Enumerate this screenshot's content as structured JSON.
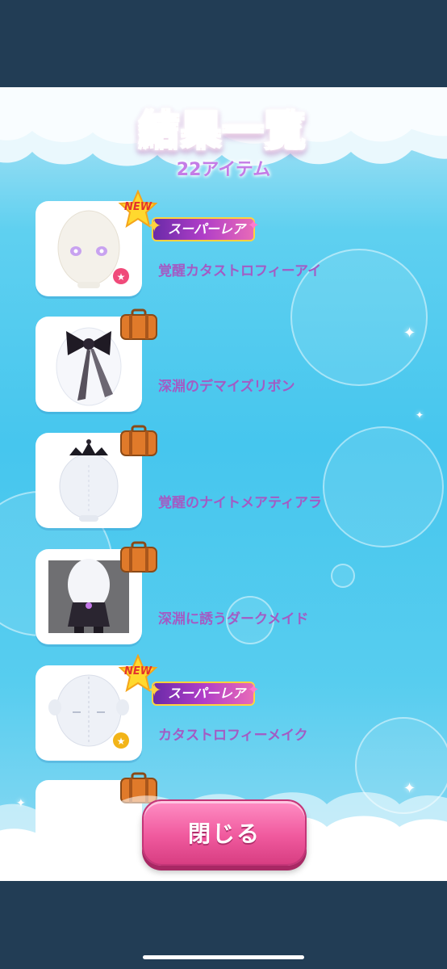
{
  "header": {
    "title": "結果一覧",
    "subtitle": "22アイテム"
  },
  "items": [
    {
      "name": "覚醒カタストロフィーアイ",
      "rarity": "スーパーレア",
      "badge": "NEW",
      "thumb_icon": "white-egg-face-with-purple-eyes-icon",
      "corner_icon": "pink-star-icon"
    },
    {
      "name": "深淵のデマイズリボン",
      "rarity": "",
      "badge": "case",
      "thumb_icon": "black-ribbon-icon",
      "corner_icon": ""
    },
    {
      "name": "覚醒のナイトメアティアラ",
      "rarity": "",
      "badge": "case",
      "thumb_icon": "tiara-avatar-icon",
      "corner_icon": ""
    },
    {
      "name": "深淵に誘うダークメイド",
      "rarity": "",
      "badge": "case",
      "thumb_icon": "dark-maid-avatar-icon",
      "corner_icon": ""
    },
    {
      "name": "カタストロフィーメイク",
      "rarity": "スーパーレア",
      "badge": "NEW",
      "thumb_icon": "stitched-avatar-icon",
      "corner_icon": "gold-star-icon"
    }
  ],
  "footer": {
    "close_label": "閉じる"
  },
  "colors": {
    "frame": "#223d55",
    "item_text": "#a35bc4",
    "close_button": "#f05a9e"
  }
}
